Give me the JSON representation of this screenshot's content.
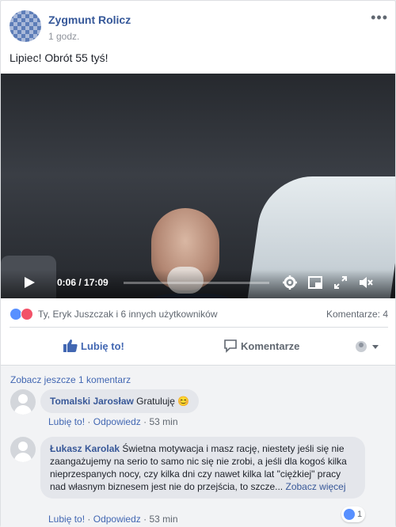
{
  "post": {
    "author": "Zygmunt Rolicz",
    "time": "1 godz.",
    "more": "•••",
    "text": "Lipiec! Obrót 55 tyś!"
  },
  "video": {
    "timecode": "0:06 / 17:09",
    "progress": 0.006
  },
  "reactions": {
    "names": "Ty, Eryk Juszczak i 6 innych użytkowników",
    "comments": "Komentarze: 4"
  },
  "actions": {
    "like": "Lubię to!",
    "comment": "Komentarze"
  },
  "comments": {
    "see_more": "Zobacz jeszcze 1 komentarz",
    "items": [
      {
        "author": "Tomalski Jarosław",
        "text": "Gratuluję 😊",
        "like": "Lubię to!",
        "reply": "Odpowiedz",
        "time": "53 min"
      },
      {
        "author": "Łukasz Karolak",
        "text": "Świetna motywacja i masz rację, niestety jeśli się nie zaangażujemy na serio to samo nic się nie zrobi, a jeśli dla kogoś kilka nieprzespanych nocy, czy kilka dni czy nawet kilka lat \"ciężkiej\" pracy nad własnym biznesem jest nie do przejścia, to szcze...",
        "see_more": "Zobacz więcej",
        "reactions": "1",
        "like": "Lubię to!",
        "reply": "Odpowiedz",
        "time": "53 min"
      }
    ]
  },
  "colors": {
    "accent": "#4267b2",
    "link": "#365899",
    "like_reaction": "#5890ff",
    "love_reaction": "#f25268"
  }
}
